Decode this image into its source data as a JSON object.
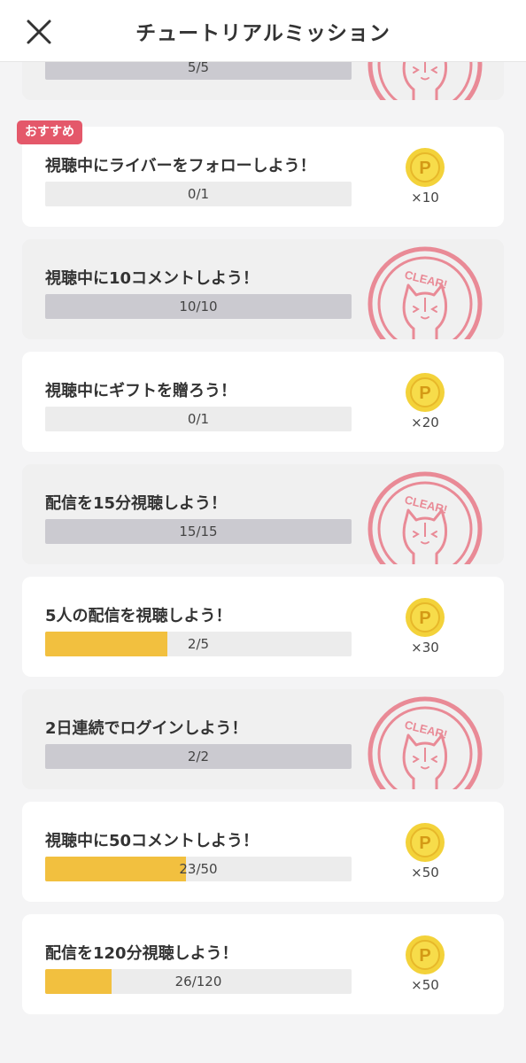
{
  "header": {
    "title": "チュートリアルミッション",
    "close_icon": "close-icon"
  },
  "colors": {
    "accent_yellow": "#f2c03f",
    "badge_pink": "#e4586a",
    "stamp_pink": "#e98a96"
  },
  "badge": {
    "label": "おすすめ"
  },
  "stamp": {
    "text": "CLEAR!"
  },
  "missions": [
    {
      "title": "",
      "progress_label": "5/5",
      "progress": 1.0,
      "completed": true
    },
    {
      "title": "視聴中にライバーをフォローしよう！",
      "progress_label": "0/1",
      "progress": 0.0,
      "completed": false,
      "reward": "×10"
    },
    {
      "title": "視聴中に10コメントしよう！",
      "progress_label": "10/10",
      "progress": 1.0,
      "completed": true
    },
    {
      "title": "視聴中にギフトを贈ろう！",
      "progress_label": "0/1",
      "progress": 0.0,
      "completed": false,
      "reward": "×20"
    },
    {
      "title": "配信を15分視聴しよう！",
      "progress_label": "15/15",
      "progress": 1.0,
      "completed": true
    },
    {
      "title": "5人の配信を視聴しよう！",
      "progress_label": "2/5",
      "progress": 0.4,
      "completed": false,
      "reward": "×30"
    },
    {
      "title": "2日連続でログインしよう！",
      "progress_label": "2/2",
      "progress": 1.0,
      "completed": true
    },
    {
      "title": "視聴中に50コメントしよう！",
      "progress_label": "23/50",
      "progress": 0.46,
      "completed": false,
      "reward": "×50"
    },
    {
      "title": "配信を120分視聴しよう！",
      "progress_label": "26/120",
      "progress": 0.2167,
      "completed": false,
      "reward": "×50"
    }
  ]
}
